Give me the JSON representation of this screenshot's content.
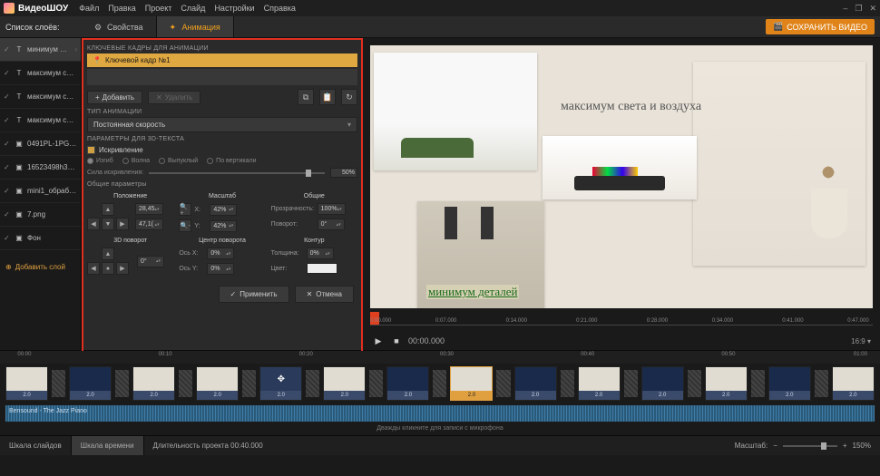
{
  "app": {
    "name": "ВидеоШОУ"
  },
  "menu": [
    "Файл",
    "Правка",
    "Проект",
    "Слайд",
    "Настройки",
    "Справка"
  ],
  "winctl": [
    "–",
    "❐",
    "✕"
  ],
  "layerPanel": {
    "title": "Список слоёв:",
    "addLayer": "Добавить слой"
  },
  "tabs": {
    "props": "Свойства",
    "anim": "Анимация"
  },
  "saveBtn": "СОХРАНИТЬ ВИДЕО",
  "layers": [
    {
      "kind": "T",
      "label": "минимум дета…",
      "sel": true
    },
    {
      "kind": "T",
      "label": "максимум свет…"
    },
    {
      "kind": "T",
      "label": "максимум свет…"
    },
    {
      "kind": "T",
      "label": "максимум свет…"
    },
    {
      "kind": "▣",
      "label": "0491PL-1PG_ин…"
    },
    {
      "kind": "▣",
      "label": "16523498h3_1-е…"
    },
    {
      "kind": "▣",
      "label": "mini1_обработа…"
    },
    {
      "kind": "▣",
      "label": "7.png"
    },
    {
      "kind": "▣",
      "label": "Фон"
    }
  ],
  "anim": {
    "keyframesHdr": "КЛЮЧЕВЫЕ КАДРЫ ДЛЯ АНИМАЦИИ",
    "keyframe1": "Ключевой кадр №1",
    "add": "Добавить",
    "del": "Удалить",
    "typeHdr": "ТИП АНИМАЦИИ",
    "typeVal": "Постоянная скорость",
    "textParamsHdr": "ПАРАМЕТРЫ ДЛЯ 3D-ТЕКСТА",
    "sparkle": "Искривление",
    "modes": [
      "Изгиб",
      "Волна",
      "Выпуклый",
      "По вертикали"
    ],
    "force": "Сила искривления:",
    "forceVal": "50%",
    "generalHdr": "Общие параметры",
    "cols": {
      "pos": "Положение",
      "scale": "Масштаб",
      "general": "Общие",
      "rot3d": "3D поворот",
      "center": "Центр поворота",
      "outline": "Контур"
    },
    "pos": {
      "x": "28,45",
      "y": "47,1("
    },
    "scale": {
      "x": "42%",
      "y": "42%",
      "xl": "X:",
      "yl": "Y:"
    },
    "gen": {
      "opacity": "Прозрачность:",
      "opv": "100%",
      "rot": "Поворот:",
      "rotv": "0°"
    },
    "rot3d": {
      "v": "0°"
    },
    "center": {
      "xl": "Ось X:",
      "xv": "0%",
      "yl": "Ось Y:",
      "yv": "0%"
    },
    "outline": {
      "thl": "Толщина:",
      "thv": "0%",
      "cll": "Цвет:"
    },
    "apply": "Применить",
    "cancel": "Отмена"
  },
  "preview": {
    "text1": "максимум света и воздуха",
    "text2": "минимум деталей",
    "ticks": [
      "0:00.000",
      "0:07.000",
      "0:14.000",
      "0:21.000",
      "0:28.000",
      "0:34.000",
      "0:41.000",
      "0:47.000"
    ],
    "time": "00:00.000",
    "ratio": "16:9"
  },
  "timeline": {
    "ticks": [
      "00:00",
      "00:10",
      "00:20",
      "00:30",
      "00:40",
      "00:50",
      "01:00"
    ],
    "clipDur": "2.0",
    "audioLabel": "Bensound - The Jazz Piano",
    "micHint": "Дважды кликните для записи с микрофона"
  },
  "bottom": {
    "slides": "Шкала слайдов",
    "time": "Шкала времени",
    "duration": "Длительность проекта 00:40.000",
    "zoomLabel": "Масштаб:",
    "zoomVal": "150%"
  }
}
